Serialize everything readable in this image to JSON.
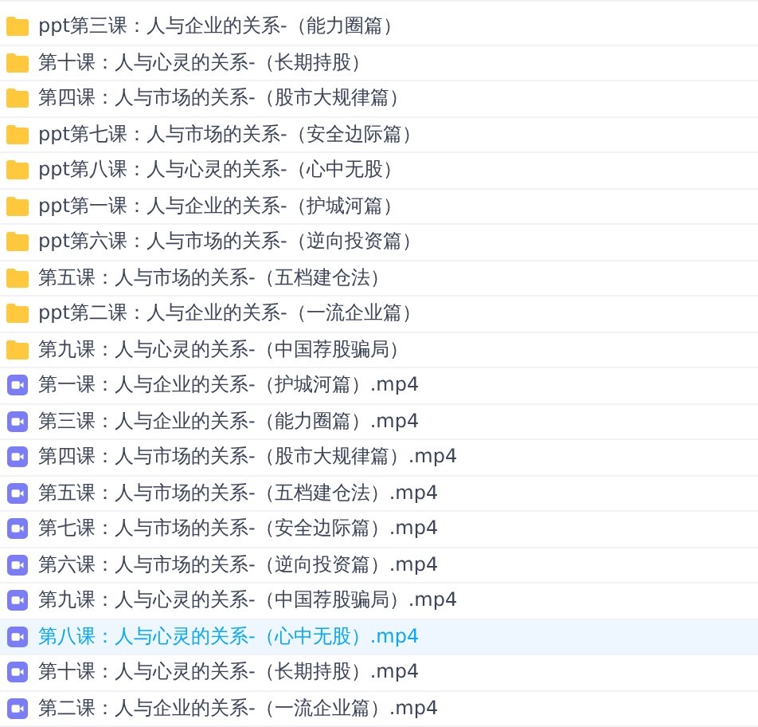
{
  "files": [
    {
      "kind": "folder",
      "name": "ppt第三课：人与企业的关系-（能力圈篇）",
      "selected": false
    },
    {
      "kind": "folder",
      "name": "第十课：人与心灵的关系-（长期持股）",
      "selected": false
    },
    {
      "kind": "folder",
      "name": "第四课：人与市场的关系-（股市大规律篇）",
      "selected": false
    },
    {
      "kind": "folder",
      "name": "ppt第七课：人与市场的关系-（安全边际篇）",
      "selected": false
    },
    {
      "kind": "folder",
      "name": "ppt第八课：人与心灵的关系-（心中无股）",
      "selected": false
    },
    {
      "kind": "folder",
      "name": "ppt第一课：人与企业的关系-（护城河篇）",
      "selected": false
    },
    {
      "kind": "folder",
      "name": "ppt第六课：人与市场的关系-（逆向投资篇）",
      "selected": false
    },
    {
      "kind": "folder",
      "name": "第五课：人与市场的关系-（五档建仓法）",
      "selected": false
    },
    {
      "kind": "folder",
      "name": "ppt第二课：人与企业的关系-（一流企业篇）",
      "selected": false
    },
    {
      "kind": "folder",
      "name": "第九课：人与心灵的关系-（中国荐股骗局）",
      "selected": false
    },
    {
      "kind": "video",
      "name": "第一课：人与企业的关系-（护城河篇）.mp4",
      "selected": false
    },
    {
      "kind": "video",
      "name": "第三课：人与企业的关系-（能力圈篇）.mp4",
      "selected": false
    },
    {
      "kind": "video",
      "name": "第四课：人与市场的关系-（股市大规律篇）.mp4",
      "selected": false
    },
    {
      "kind": "video",
      "name": "第五课：人与市场的关系-（五档建仓法）.mp4",
      "selected": false
    },
    {
      "kind": "video",
      "name": "第七课：人与市场的关系-（安全边际篇）.mp4",
      "selected": false
    },
    {
      "kind": "video",
      "name": "第六课：人与市场的关系-（逆向投资篇）.mp4",
      "selected": false
    },
    {
      "kind": "video",
      "name": "第九课：人与心灵的关系-（中国荐股骗局）.mp4",
      "selected": false
    },
    {
      "kind": "video",
      "name": "第八课：人与心灵的关系-（心中无股）.mp4",
      "selected": true
    },
    {
      "kind": "video",
      "name": "第十课：人与心灵的关系-（长期持股）.mp4",
      "selected": false
    },
    {
      "kind": "video",
      "name": "第二课：人与企业的关系-（一流企业篇）.mp4",
      "selected": false
    }
  ]
}
